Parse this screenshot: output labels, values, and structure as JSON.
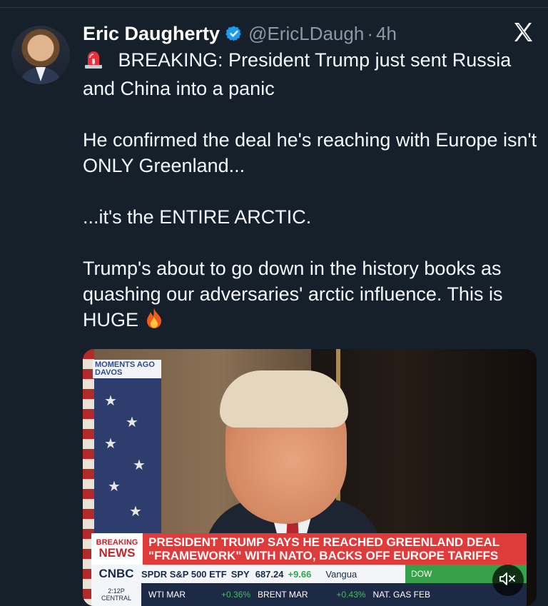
{
  "author": {
    "name": "Eric Daugherty",
    "handle": "@EricLDaugh",
    "separator": "·",
    "time": "4h"
  },
  "tweet": {
    "lines": [
      "BREAKING: President Trump just sent Russia and China into a panic",
      "He confirmed the deal he's reaching with Europe isn't ONLY Greenland...",
      "...it's the ENTIRE ARCTIC.",
      "Trump's about to go down in the history books as quashing our adversaries' arctic influence. This is HUGE"
    ]
  },
  "media": {
    "bug_line1": "MOMENTS AGO",
    "bug_line2": "DAVOS",
    "breaking_label1": "BREAKING",
    "breaking_label2": "NEWS",
    "headline_line1": "PRESIDENT TRUMP SAYS HE REACHED GREENLAND DEAL",
    "headline_line2": "\"FRAMEWORK\" WITH NATO, BACKS OFF EUROPE TARIFFS",
    "network": "CNBC",
    "ticker_label": "SPDR S&P 500 ETF",
    "ticker_symbol": "SPY",
    "ticker_price": "687.24",
    "ticker_change": "+9.66",
    "ticker_next": "Vangua",
    "dow_label": "DOW",
    "time_line1": "2:12P",
    "time_line2": "CENTRAL",
    "wti": "WTI MAR",
    "wti_pct": "+0.36%",
    "brent": "BRENT MAR",
    "brent_pct": "+0.43%",
    "natgas": "NAT. GAS FEB"
  },
  "colors": {
    "background": "#15202b",
    "verified": "#1d9bf0",
    "secondary_text": "#8b98a5",
    "breaking_red": "#e03b3b"
  },
  "icons": {
    "verified": "verified-badge-icon",
    "x_logo": "x-logo-icon",
    "siren": "siren-emoji-icon",
    "fire": "fire-emoji-icon",
    "mute": "speaker-mute-icon"
  }
}
